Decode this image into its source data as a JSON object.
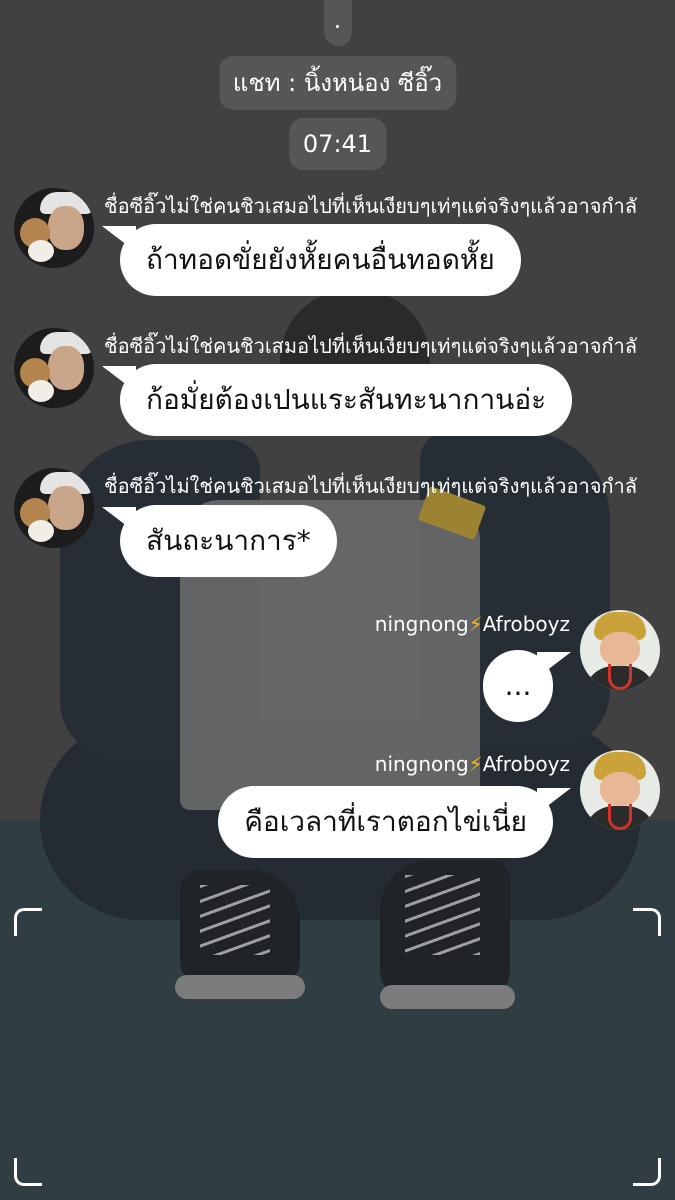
{
  "header": {
    "dot": ".",
    "title": "แชท : นิ้งหน่อง ซีอิ๊ว",
    "time": "07:41"
  },
  "messages": [
    {
      "side": "left",
      "sender": "ชื่อซีอิ๊วไม่ใช่คนชิวเสมอไปที่เห็นเงียบๆเท่ๆแต่จริงๆแล้วอาจกำลั",
      "text": "ถ้าทอดขั่ยยังหั้ยคนอื่นทอดหั้ย"
    },
    {
      "side": "left",
      "sender": "ชื่อซีอิ๊วไม่ใช่คนชิวเสมอไปที่เห็นเงียบๆเท่ๆแต่จริงๆแล้วอาจกำลั",
      "text": "ก้อมั่ยต้องเปนแระสันทะนากานอ่ะ"
    },
    {
      "side": "left",
      "sender": "ชื่อซีอิ๊วไม่ใช่คนชิวเสมอไปที่เห็นเงียบๆเท่ๆแต่จริงๆแล้วอาจกำลั",
      "text": "สันถะนาการ*"
    },
    {
      "side": "right",
      "sender_name": "ningnong",
      "sender_suffix": "Afroboyz",
      "text": "..."
    },
    {
      "side": "right",
      "sender_name": "ningnong",
      "sender_suffix": "Afroboyz",
      "text": "คือเวลาที่เราตอกไข่เนี่ย"
    }
  ],
  "icons": {
    "bolt": "⚡"
  },
  "colors": {
    "bubble": "#ffffff",
    "bolt": "#f2b91c",
    "header_pill": "#5a5a5a"
  }
}
